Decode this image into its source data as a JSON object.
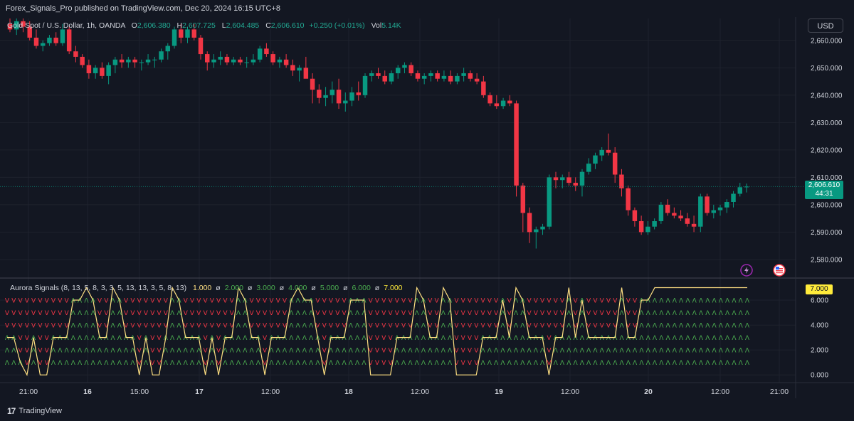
{
  "header": {
    "publisher_line": "Forex_Signals_Pro published on TradingView.com, Dec 20, 2024 16:15 UTC+8"
  },
  "legend": {
    "symbol": "Gold Spot / U.S. Dollar, 1h, OANDA",
    "o_label": "O",
    "o_value": "2,606.380",
    "h_label": "H",
    "h_value": "2,607.725",
    "l_label": "L",
    "l_value": "2,604.485",
    "c_label": "C",
    "c_value": "2,606.610",
    "change": "+0.250 (+0.01%)",
    "vol_label": "Vol",
    "vol_value": "5.14K"
  },
  "currency_button": "USD",
  "price_badge": {
    "price": "2,606.610",
    "countdown": "44:31"
  },
  "indicator": {
    "name": "Aurora Signals (8, 13, 5, 8, 3, 3, 5, 13, 13, 3, 5, 8, 13)",
    "values": [
      "1.000",
      "ø",
      "2.000",
      "ø",
      "3.000",
      "ø",
      "4.000",
      "ø",
      "5.000",
      "ø",
      "6.000",
      "ø",
      "7.000"
    ],
    "badge": "7.000"
  },
  "brand": {
    "logo": "17",
    "name": "TradingView"
  },
  "colors": {
    "up": "#089981",
    "down": "#f23645",
    "line": "#ffe082",
    "bg": "#131722",
    "grid": "#1e222d",
    "text": "#d1d4dc",
    "signal_up": "#4caf50",
    "signal_down": "#f23645"
  },
  "icons": [
    "lightning-icon",
    "us-flag-icon"
  ],
  "chart_data": [
    {
      "type": "candlestick",
      "title": "Gold Spot / U.S. Dollar, 1h, OANDA",
      "ylim": [
        2574,
        2668
      ],
      "y_ticks": [
        "2,660.000",
        "2,650.000",
        "2,640.000",
        "2,630.000",
        "2,620.000",
        "2,610.000",
        "2,600.000",
        "2,590.000",
        "2,580.000"
      ],
      "y_tick_values": [
        2660,
        2650,
        2640,
        2630,
        2620,
        2610,
        2600,
        2590,
        2580
      ],
      "x_ticks": [
        "21:00",
        "16",
        "15:00",
        "17",
        "12:00",
        "18",
        "12:00",
        "19",
        "12:00",
        "20",
        "12:00",
        "21:00"
      ],
      "last_price": 2606.61,
      "candles": [
        [
          2666,
          2668,
          2663,
          2664
        ],
        [
          2664,
          2668,
          2662,
          2667
        ],
        [
          2667,
          2668,
          2663,
          2665
        ],
        [
          2665,
          2667,
          2660,
          2661
        ],
        [
          2661,
          2664,
          2657,
          2658
        ],
        [
          2658,
          2660,
          2656,
          2659
        ],
        [
          2659,
          2662,
          2658,
          2661
        ],
        [
          2661,
          2663,
          2658,
          2659
        ],
        [
          2659,
          2666,
          2658,
          2664
        ],
        [
          2664,
          2665,
          2655,
          2656
        ],
        [
          2656,
          2658,
          2652,
          2654
        ],
        [
          2654,
          2655,
          2650,
          2651
        ],
        [
          2651,
          2653,
          2646,
          2648
        ],
        [
          2648,
          2651,
          2646,
          2650
        ],
        [
          2650,
          2652,
          2646,
          2647
        ],
        [
          2647,
          2652,
          2644,
          2651
        ],
        [
          2651,
          2654,
          2648,
          2653
        ],
        [
          2653,
          2655,
          2650,
          2652
        ],
        [
          2652,
          2654,
          2650,
          2653
        ],
        [
          2653,
          2654,
          2650,
          2652
        ],
        [
          2652,
          2653,
          2649,
          2652
        ],
        [
          2652,
          2655,
          2651,
          2653
        ],
        [
          2653,
          2654,
          2650,
          2653
        ],
        [
          2653,
          2657,
          2652,
          2656
        ],
        [
          2656,
          2659,
          2653,
          2658
        ],
        [
          2658,
          2665,
          2657,
          2664
        ],
        [
          2664,
          2666,
          2659,
          2661
        ],
        [
          2661,
          2665,
          2659,
          2664
        ],
        [
          2664,
          2666,
          2660,
          2661
        ],
        [
          2661,
          2662,
          2653,
          2655
        ],
        [
          2655,
          2656,
          2649,
          2652
        ],
        [
          2652,
          2655,
          2650,
          2653
        ],
        [
          2653,
          2656,
          2651,
          2654
        ],
        [
          2654,
          2655,
          2651,
          2652
        ],
        [
          2652,
          2654,
          2651,
          2653
        ],
        [
          2653,
          2654,
          2651,
          2652
        ],
        [
          2652,
          2654,
          2650,
          2652
        ],
        [
          2652,
          2655,
          2651,
          2653
        ],
        [
          2653,
          2658,
          2652,
          2657
        ],
        [
          2657,
          2659,
          2654,
          2655
        ],
        [
          2655,
          2656,
          2651,
          2652
        ],
        [
          2652,
          2654,
          2650,
          2653
        ],
        [
          2653,
          2655,
          2650,
          2651
        ],
        [
          2651,
          2653,
          2647,
          2649
        ],
        [
          2649,
          2651,
          2645,
          2650
        ],
        [
          2650,
          2654,
          2647,
          2646
        ],
        [
          2646,
          2648,
          2637,
          2642
        ],
        [
          2642,
          2644,
          2637,
          2639
        ],
        [
          2639,
          2643,
          2636,
          2640
        ],
        [
          2640,
          2645,
          2637,
          2642
        ],
        [
          2642,
          2646,
          2635,
          2637
        ],
        [
          2637,
          2641,
          2634,
          2638
        ],
        [
          2638,
          2643,
          2636,
          2641
        ],
        [
          2641,
          2645,
          2638,
          2640
        ],
        [
          2640,
          2648,
          2639,
          2647
        ],
        [
          2647,
          2649,
          2645,
          2648
        ],
        [
          2648,
          2650,
          2646,
          2647
        ],
        [
          2647,
          2649,
          2644,
          2645
        ],
        [
          2645,
          2649,
          2644,
          2648
        ],
        [
          2648,
          2651,
          2646,
          2650
        ],
        [
          2650,
          2652,
          2648,
          2651
        ],
        [
          2651,
          2652,
          2647,
          2648
        ],
        [
          2648,
          2649,
          2645,
          2646
        ],
        [
          2646,
          2648,
          2644,
          2647
        ],
        [
          2647,
          2649,
          2645,
          2648
        ],
        [
          2648,
          2649,
          2645,
          2646
        ],
        [
          2646,
          2649,
          2645,
          2647
        ],
        [
          2647,
          2649,
          2644,
          2645
        ],
        [
          2645,
          2648,
          2644,
          2647
        ],
        [
          2647,
          2650,
          2645,
          2648
        ],
        [
          2648,
          2649,
          2645,
          2646
        ],
        [
          2646,
          2648,
          2644,
          2645
        ],
        [
          2645,
          2647,
          2639,
          2640
        ],
        [
          2640,
          2641,
          2636,
          2637
        ],
        [
          2637,
          2640,
          2635,
          2636
        ],
        [
          2636,
          2639,
          2635,
          2638
        ],
        [
          2638,
          2640,
          2636,
          2637
        ],
        [
          2637,
          2638,
          2603,
          2607
        ],
        [
          2607,
          2608,
          2590,
          2597
        ],
        [
          2597,
          2599,
          2586,
          2590
        ],
        [
          2590,
          2592,
          2584,
          2591
        ],
        [
          2591,
          2593,
          2589,
          2592
        ],
        [
          2592,
          2611,
          2591,
          2610
        ],
        [
          2610,
          2612,
          2606,
          2609
        ],
        [
          2609,
          2611,
          2606,
          2610
        ],
        [
          2610,
          2612,
          2607,
          2608
        ],
        [
          2608,
          2610,
          2605,
          2607
        ],
        [
          2607,
          2613,
          2603,
          2612
        ],
        [
          2612,
          2617,
          2611,
          2615
        ],
        [
          2615,
          2619,
          2613,
          2618
        ],
        [
          2618,
          2621,
          2616,
          2620
        ],
        [
          2620,
          2626,
          2618,
          2619
        ],
        [
          2619,
          2621,
          2608,
          2611
        ],
        [
          2611,
          2613,
          2603,
          2606
        ],
        [
          2606,
          2607,
          2596,
          2598
        ],
        [
          2598,
          2599,
          2592,
          2594
        ],
        [
          2594,
          2596,
          2589,
          2590
        ],
        [
          2590,
          2594,
          2589,
          2592
        ],
        [
          2592,
          2595,
          2591,
          2594
        ],
        [
          2594,
          2601,
          2593,
          2600
        ],
        [
          2600,
          2602,
          2596,
          2597
        ],
        [
          2597,
          2599,
          2595,
          2596
        ],
        [
          2596,
          2598,
          2594,
          2595
        ],
        [
          2595,
          2597,
          2592,
          2593
        ],
        [
          2593,
          2596,
          2590,
          2592
        ],
        [
          2592,
          2604,
          2590,
          2603
        ],
        [
          2603,
          2604,
          2596,
          2597
        ],
        [
          2597,
          2600,
          2595,
          2598
        ],
        [
          2598,
          2600,
          2596,
          2599
        ],
        [
          2599,
          2602,
          2597,
          2601
        ],
        [
          2601,
          2605,
          2599,
          2604
        ],
        [
          2604,
          2608,
          2603,
          2606.38
        ],
        [
          2606.38,
          2607.725,
          2604.485,
          2606.61
        ]
      ]
    },
    {
      "type": "line",
      "title": "Aurora Signals (8, 13, 5, 8, 3, 3, 5, 13, 13, 3, 5, 8, 13)",
      "ylim": [
        -0.5,
        7.6
      ],
      "y_ticks": [
        "6.000",
        "4.000",
        "2.000",
        "0.000"
      ],
      "y_tick_values": [
        6,
        4,
        2,
        0
      ],
      "signal_rows": [
        1,
        2,
        3,
        4,
        5,
        6
      ],
      "values": [
        3,
        3,
        1,
        0,
        3,
        0,
        0,
        3,
        3,
        3,
        6,
        6,
        7,
        6,
        3,
        3,
        7,
        6,
        3,
        3,
        0,
        3,
        0,
        0,
        3,
        7,
        6,
        3,
        3,
        3,
        0,
        3,
        0,
        3,
        3,
        7,
        6,
        3,
        3,
        0,
        3,
        3,
        3,
        6,
        7,
        6,
        6,
        3,
        0,
        3,
        3,
        3,
        6,
        6,
        6,
        0,
        0,
        0,
        0,
        3,
        3,
        3,
        7,
        6,
        3,
        3,
        7,
        6,
        0,
        0,
        0,
        0,
        3,
        3,
        3,
        6,
        3,
        7,
        6,
        3,
        3,
        3,
        0,
        3,
        3,
        7,
        3,
        6,
        3,
        3,
        3,
        3,
        3,
        7,
        3,
        3,
        6,
        6,
        7,
        7,
        7,
        7,
        7,
        7,
        7,
        7,
        7,
        7,
        7,
        7,
        7,
        7,
        7
      ]
    }
  ]
}
